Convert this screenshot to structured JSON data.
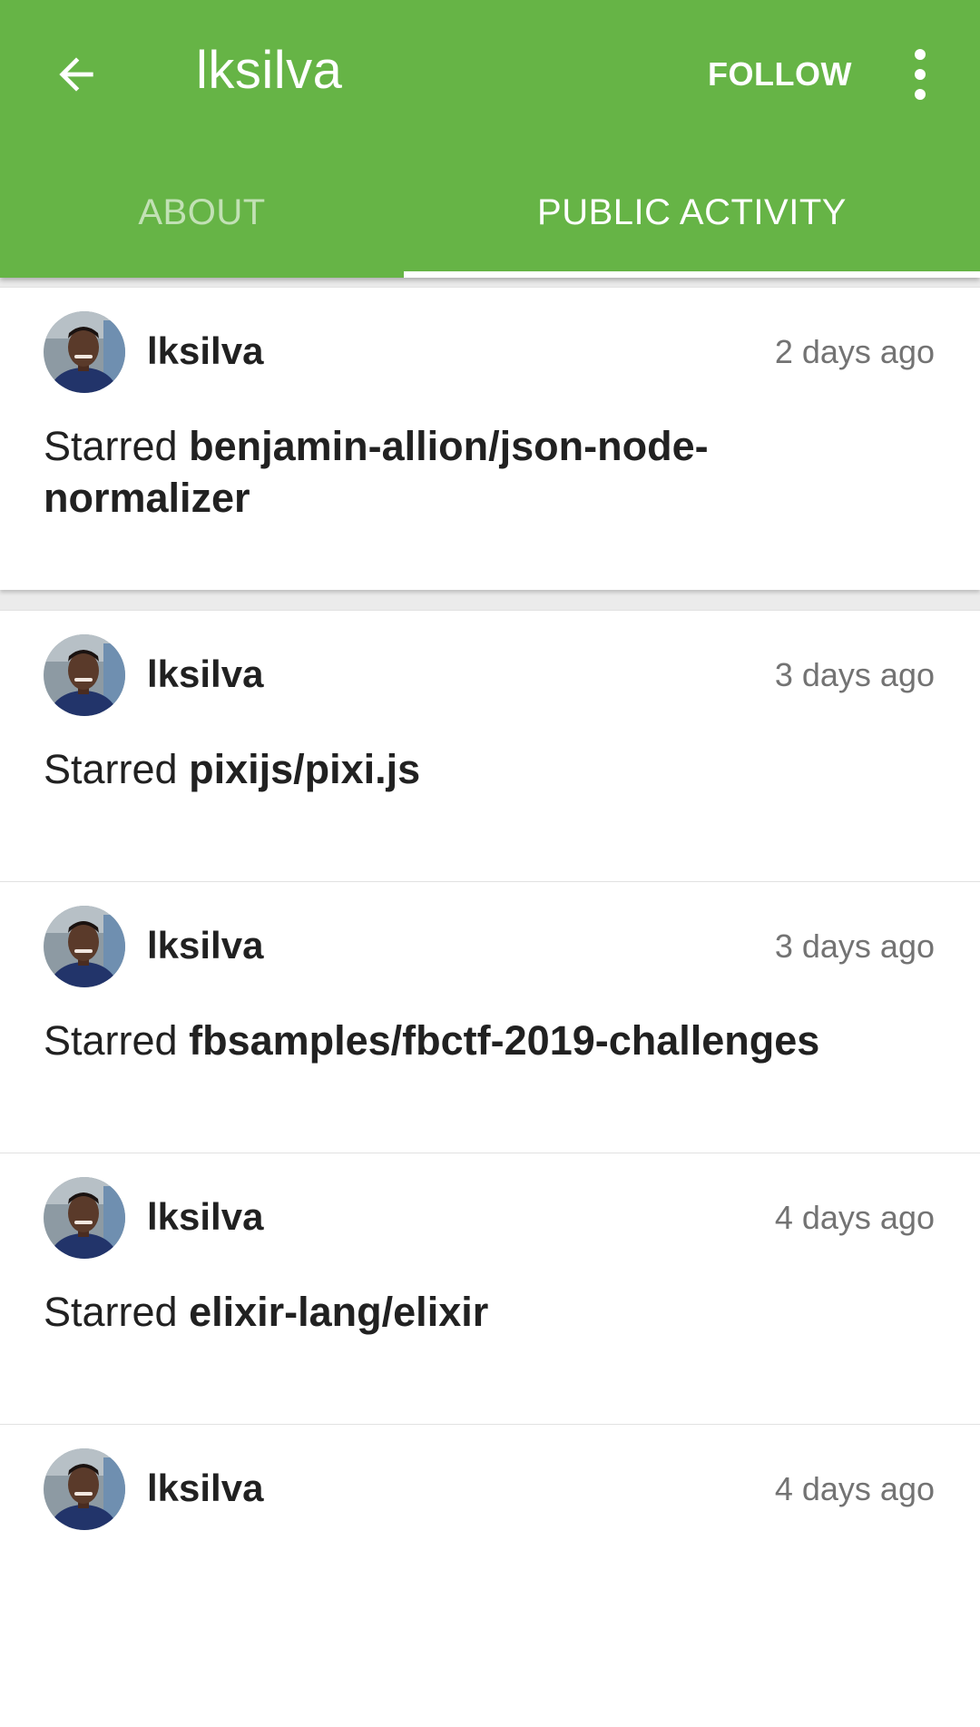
{
  "toolbar": {
    "title": "lksilva",
    "follow_label": "FOLLOW",
    "back_icon": "arrow-back-icon",
    "menu_icon": "more-vert-icon"
  },
  "tabs": [
    {
      "label": "ABOUT",
      "active": false
    },
    {
      "label": "PUBLIC ACTIVITY",
      "active": true
    }
  ],
  "colors": {
    "primary": "#66b446",
    "text": "#212121",
    "secondary_text": "#737373"
  },
  "activity": [
    {
      "user": "lksilva",
      "time": "2 days ago",
      "action": "Starred",
      "repo": "benjamin-allion/json-node-normalizer"
    },
    {
      "user": "lksilva",
      "time": "3 days ago",
      "action": "Starred",
      "repo": "pixijs/pixi.js"
    },
    {
      "user": "lksilva",
      "time": "3 days ago",
      "action": "Starred",
      "repo": "fbsamples/fbctf-2019-challenges"
    },
    {
      "user": "lksilva",
      "time": "4 days ago",
      "action": "Starred",
      "repo": "elixir-lang/elixir"
    },
    {
      "user": "lksilva",
      "time": "4 days ago",
      "action": "",
      "repo": ""
    }
  ]
}
